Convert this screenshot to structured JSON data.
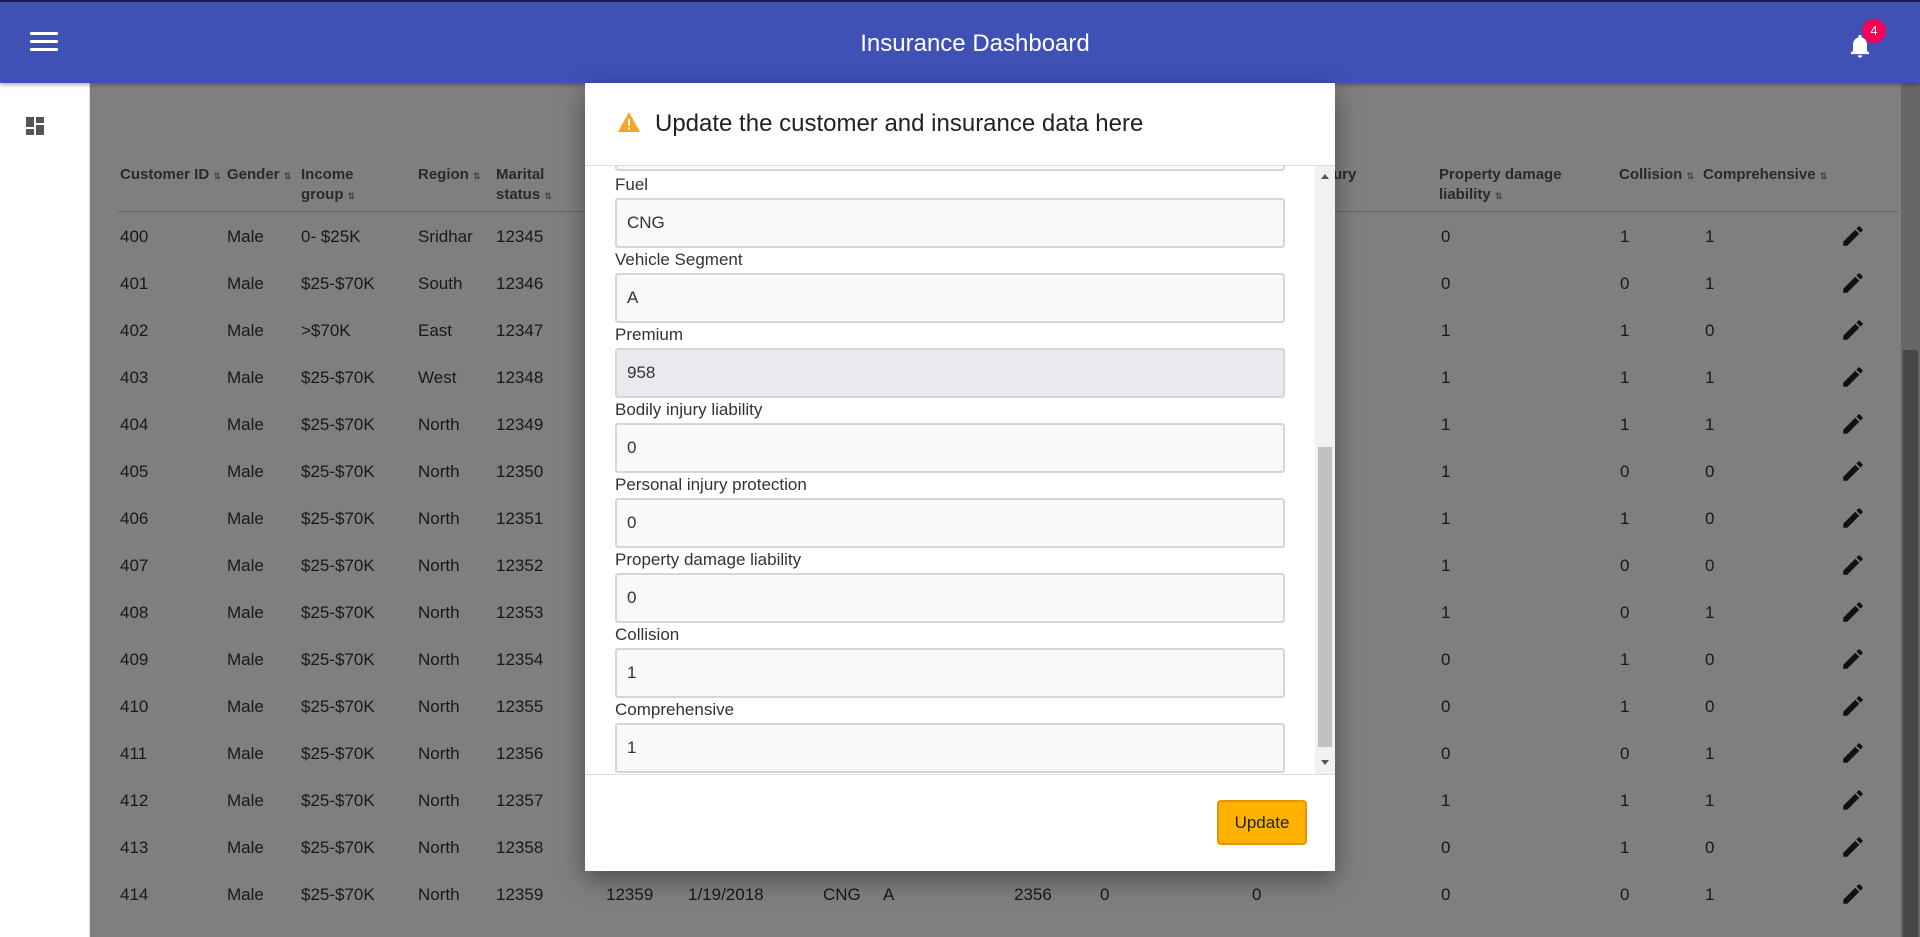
{
  "header": {
    "title": "Insurance Dashboard",
    "notification_count": "4"
  },
  "table": {
    "columns": [
      {
        "label": "Customer ID"
      },
      {
        "label": "Gender"
      },
      {
        "label": "Income group"
      },
      {
        "label": "Region"
      },
      {
        "label": "Marital status"
      },
      {
        "label": "ury"
      },
      {
        "label": "Property damage liability"
      },
      {
        "label": "Collision"
      },
      {
        "label": "Comprehensive"
      }
    ],
    "rows": [
      {
        "id": "400",
        "gender": "Male",
        "income": "0- $25K",
        "region": "Sridhar",
        "marital": "12345",
        "pdl": "0",
        "collision": "1",
        "comprehensive": "1"
      },
      {
        "id": "401",
        "gender": "Male",
        "income": "$25-$70K",
        "region": "South",
        "marital": "12346",
        "pdl": "0",
        "collision": "0",
        "comprehensive": "1"
      },
      {
        "id": "402",
        "gender": "Male",
        "income": ">$70K",
        "region": "East",
        "marital": "12347",
        "pdl": "1",
        "collision": "1",
        "comprehensive": "0"
      },
      {
        "id": "403",
        "gender": "Male",
        "income": "$25-$70K",
        "region": "West",
        "marital": "12348",
        "pdl": "1",
        "collision": "1",
        "comprehensive": "1"
      },
      {
        "id": "404",
        "gender": "Male",
        "income": "$25-$70K",
        "region": "North",
        "marital": "12349",
        "pdl": "1",
        "collision": "1",
        "comprehensive": "1"
      },
      {
        "id": "405",
        "gender": "Male",
        "income": "$25-$70K",
        "region": "North",
        "marital": "12350",
        "pdl": "1",
        "collision": "0",
        "comprehensive": "0"
      },
      {
        "id": "406",
        "gender": "Male",
        "income": "$25-$70K",
        "region": "North",
        "marital": "12351",
        "pdl": "1",
        "collision": "1",
        "comprehensive": "0"
      },
      {
        "id": "407",
        "gender": "Male",
        "income": "$25-$70K",
        "region": "North",
        "marital": "12352",
        "pdl": "1",
        "collision": "0",
        "comprehensive": "0"
      },
      {
        "id": "408",
        "gender": "Male",
        "income": "$25-$70K",
        "region": "North",
        "marital": "12353",
        "pdl": "1",
        "collision": "0",
        "comprehensive": "1"
      },
      {
        "id": "409",
        "gender": "Male",
        "income": "$25-$70K",
        "region": "North",
        "marital": "12354",
        "pdl": "0",
        "collision": "1",
        "comprehensive": "0"
      },
      {
        "id": "410",
        "gender": "Male",
        "income": "$25-$70K",
        "region": "North",
        "marital": "12355",
        "pdl": "0",
        "collision": "1",
        "comprehensive": "0"
      },
      {
        "id": "411",
        "gender": "Male",
        "income": "$25-$70K",
        "region": "North",
        "marital": "12356",
        "pdl": "0",
        "collision": "0",
        "comprehensive": "1"
      },
      {
        "id": "412",
        "gender": "Male",
        "income": "$25-$70K",
        "region": "North",
        "marital": "12357",
        "pdl": "1",
        "collision": "1",
        "comprehensive": "1"
      },
      {
        "id": "413",
        "gender": "Male",
        "income": "$25-$70K",
        "region": "North",
        "marital": "12358",
        "pdl": "0",
        "collision": "1",
        "comprehensive": "0"
      },
      {
        "id": "414",
        "gender": "Male",
        "income": "$25-$70K",
        "region": "North",
        "marital": "12359",
        "extra1": "12359",
        "date": "1/19/2018",
        "fuel": "CNG",
        "segment": "A",
        "premium": "2356",
        "bil": "0",
        "pip": "0",
        "pdl": "0",
        "collision": "0",
        "comprehensive": "1"
      }
    ]
  },
  "dialog": {
    "title": "Update the customer and insurance data here",
    "fields": [
      {
        "label": "Fuel",
        "value": "CNG",
        "readonly": false
      },
      {
        "label": "Vehicle Segment",
        "value": "A",
        "readonly": false
      },
      {
        "label": "Premium",
        "value": "958",
        "readonly": true
      },
      {
        "label": "Bodily injury liability",
        "value": "0",
        "readonly": false
      },
      {
        "label": "Personal injury protection",
        "value": "0",
        "readonly": false
      },
      {
        "label": "Property damage liability",
        "value": "0",
        "readonly": false
      },
      {
        "label": "Collision",
        "value": "1",
        "readonly": false
      },
      {
        "label": "Comprehensive",
        "value": "1",
        "readonly": false
      }
    ],
    "update_label": "Update"
  },
  "colors": {
    "header": "#3f51b5",
    "badge": "#f50057",
    "button": "#ffb300",
    "warning": "#f5a623"
  },
  "icons": [
    "menu-icon",
    "bell-icon",
    "dashboard-icon",
    "warning-icon",
    "edit-icon"
  ]
}
